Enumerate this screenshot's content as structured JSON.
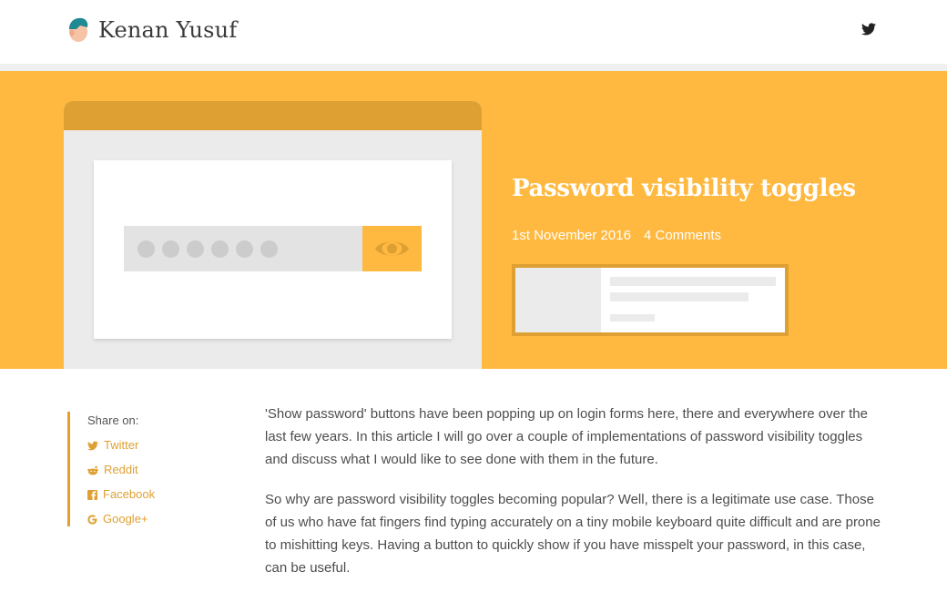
{
  "header": {
    "site_title": "Kenan Yusuf",
    "icons": {
      "avatar": "avatar-icon",
      "twitter": "twitter-icon"
    }
  },
  "post": {
    "title": "Password visibility toggles",
    "date": "1st November 2016",
    "comments": "4 Comments"
  },
  "hero_illustration": {
    "password_dot_count": 6,
    "eye_icon": "eye-icon"
  },
  "share": {
    "title": "Share on:",
    "items": [
      {
        "label": "Twitter",
        "icon": "twitter-icon"
      },
      {
        "label": "Reddit",
        "icon": "reddit-icon"
      },
      {
        "label": "Facebook",
        "icon": "facebook-icon"
      },
      {
        "label": "Google+",
        "icon": "google-icon"
      }
    ]
  },
  "article": {
    "paragraphs": [
      "'Show password' buttons have been popping up on login forms here, there and everywhere over the last few years. In this article I will go over a couple of implementations of password visibility toggles and discuss what I would like to see done with them in the future.",
      "So why are password visibility toggles becoming popular? Well, there is a legitimate use case. Those of us who have fat fingers find typing accurately on a tiny mobile keyboard quite difficult and are prone to mishitting keys. Having a button to quickly show if you have misspelt your password, in this case, can be useful."
    ]
  },
  "colors": {
    "accent": "#ffb940",
    "accent_dark": "#dea033",
    "share_border": "#e59e2c",
    "text": "#4d4d4d"
  }
}
